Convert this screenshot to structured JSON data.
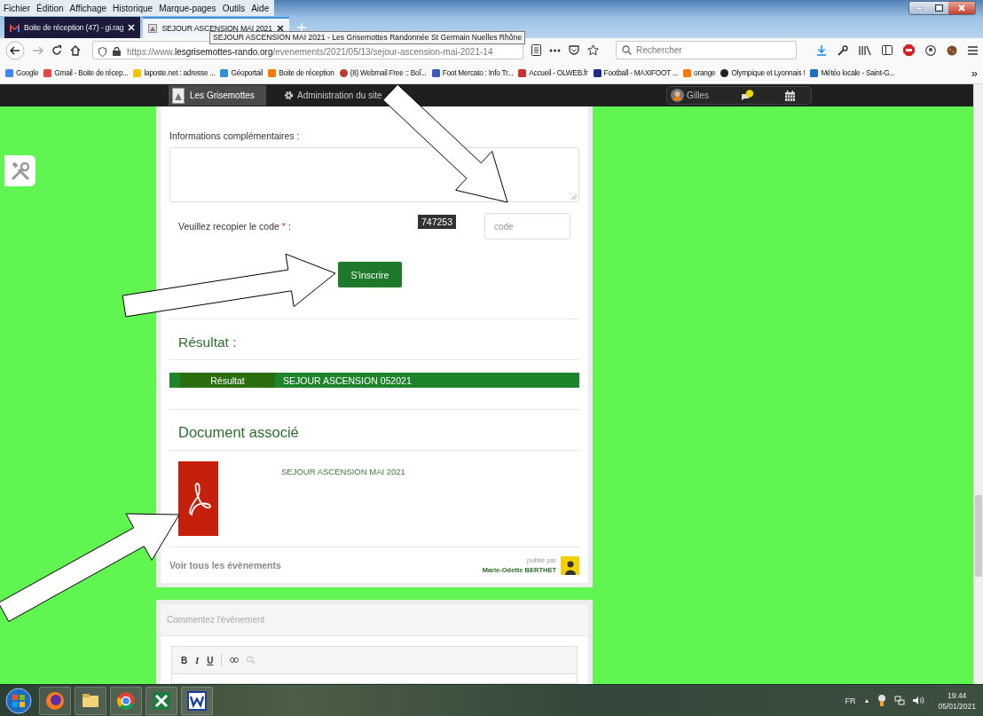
{
  "menu_bar": [
    "Fichier",
    "Édition",
    "Affichage",
    "Historique",
    "Marque-pages",
    "Outils",
    "Aide"
  ],
  "tabs": [
    {
      "label": "Boite de réception (47) - gi.rag",
      "selected": false
    },
    {
      "label": "SEJOUR ASCENSION MAI 2021",
      "selected": true
    }
  ],
  "tooltip": "SEJOUR ASCENSION MAI 2021 - Les Grisemottes Randonnée St Germain Nuelles Rhône",
  "address_bar": {
    "prefix": "https://www.",
    "domain": "lesgrisemottes-rando.org",
    "path": "/evenements/2021/05/13/sejour-ascension-mai-2021-14"
  },
  "search": {
    "placeholder": "Rechercher"
  },
  "bookmarks": [
    "Google",
    "Gmail - Boite de récep...",
    "laposte.net : adresse ...",
    "Géoportail",
    "Boite de réception",
    "(8) Webmail Free :: Boî...",
    "Foot Mercato : Info Tr...",
    "Accueil - OLWEB.fr",
    "Football - MAXIFOOT ...",
    "orange",
    "Olympique et Lyonnais !",
    "Météo locale - Saint-G..."
  ],
  "bookmarks_more": "»",
  "admin_bar": {
    "site": "Les Grisemottes",
    "admin": "Administration du site",
    "user": "Gilles"
  },
  "form": {
    "info_label": "Informations complémentaires :",
    "code_label": "Veuillez recopier le code",
    "required_mark": "*",
    "code_suffix": ":",
    "captcha": "747253",
    "code_placeholder": "code",
    "submit": "S'inscrire"
  },
  "result": {
    "heading": "Résultat :",
    "row": [
      "Résultat",
      "SEJOUR ASCENSION 052021"
    ]
  },
  "documents": {
    "heading": "Document associé",
    "items": [
      {
        "title": "SEJOUR ASCENSION MAI 2021"
      }
    ]
  },
  "footer": {
    "link": "Voir tous les évènements",
    "published_by": "publié par",
    "author": "Marie-Odette BERTHET"
  },
  "comment": {
    "title": "Commentez l'évènement",
    "toolbar": [
      "B",
      "I",
      "U"
    ]
  },
  "taskbar": {
    "language": "FR",
    "tray_toggle": "▲",
    "time": "19:44",
    "date": "05/01/2021"
  }
}
